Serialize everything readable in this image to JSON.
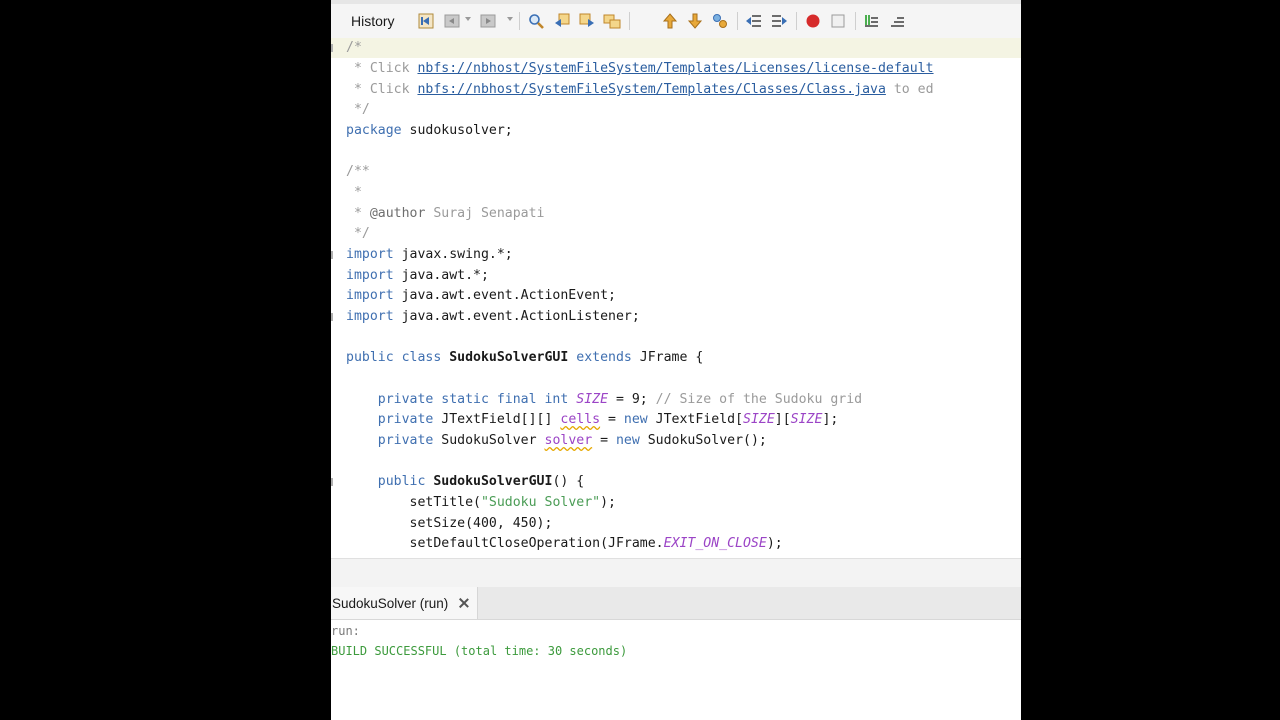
{
  "toolbar": {
    "history_label": "History",
    "icons": [
      "back-to-last-edit-icon",
      "prev-history-icon",
      "next-history-icon",
      "find-icon",
      "find-previous-icon",
      "find-next-icon",
      "toggle-highlight-icon",
      "prev-bookmark-icon",
      "next-bookmark-icon",
      "toggle-bookmark-icon",
      "shift-left-icon",
      "shift-right-icon",
      "record-macro-icon",
      "stop-macro-icon",
      "comment-icon",
      "uncomment-icon"
    ]
  },
  "editor": {
    "lines": {
      "l1": "/*",
      "l2_prefix": " * Click ",
      "l2_link": "nbfs://nbhost/SystemFileSystem/Templates/Licenses/license-default",
      "l3_prefix": " * Click ",
      "l3_link": "nbfs://nbhost/SystemFileSystem/Templates/Classes/Class.java",
      "l3_suffix": " to ed",
      "l4": " */",
      "l5_kw": "package",
      "l5_rest": " sudokusolver;",
      "l7": "/**",
      "l8": " *",
      "l9_prefix": " * ",
      "l9_tag": "@author",
      "l9_rest": " Suraj Senapati",
      "l10": " */",
      "l11_kw": "import",
      "l11_rest": " javax.swing.*;",
      "l12_kw": "import",
      "l12_rest": " java.awt.*;",
      "l13_kw": "import",
      "l13_rest": " java.awt.event.ActionEvent;",
      "l14_kw": "import",
      "l14_rest": " java.awt.event.ActionListener;",
      "l16_kw1": "public class ",
      "l16_name": "SudokuSolverGUI",
      "l16_kw2": " extends ",
      "l16_rest": "JFrame {",
      "l18_kw": "    private static final int ",
      "l18_const": "SIZE",
      "l18_rest": " = 9; ",
      "l18_cm": "// Size of the Sudoku grid",
      "l19_kw": "    private ",
      "l19_type": "JTextField[][] ",
      "l19_field": "cells",
      "l19_eq": " = ",
      "l19_new": "new ",
      "l19_type2": "JTextField[",
      "l19_c1": "SIZE",
      "l19_mid": "][",
      "l19_c2": "SIZE",
      "l19_end": "];",
      "l20_kw": "    private ",
      "l20_type": "SudokuSolver ",
      "l20_field": "solver",
      "l20_eq": " = ",
      "l20_new": "new ",
      "l20_rest": "SudokuSolver();",
      "l22_kw": "    public ",
      "l22_name": "SudokuSolverGUI",
      "l22_rest": "() {",
      "l23_pre": "        setTitle(",
      "l23_str": "\"Sudoku Solver\"",
      "l23_end": ");",
      "l24": "        setSize(400, 450);",
      "l25_pre": "        setDefaultCloseOperation(JFrame.",
      "l25_const": "EXIT_ON_CLOSE",
      "l25_end": ");"
    }
  },
  "output": {
    "tab_label": "SudokuSolver (run)",
    "run_text": "run:",
    "build_text": "BUILD SUCCESSFUL (total time: 30 seconds)"
  },
  "colors": {
    "keyword": "#3f6fb0",
    "comment": "#9a9a9a",
    "string": "#4a9c55",
    "constant": "#9b44c6",
    "build_success": "#3c9a3c"
  }
}
